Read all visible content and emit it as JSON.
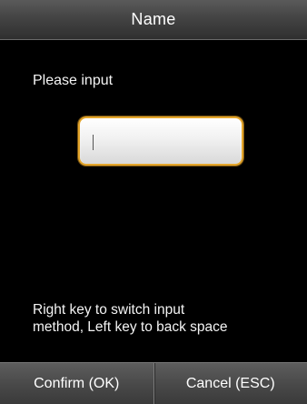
{
  "header": {
    "title": "Name"
  },
  "main": {
    "prompt": "Please input",
    "input": {
      "value": "",
      "caret_visible": true
    },
    "hint_lines": [
      "Right key to switch input",
      "method, Left key to back space"
    ]
  },
  "footer": {
    "confirm_label": "Confirm (OK)",
    "cancel_label": "Cancel (ESC)"
  },
  "colors": {
    "background": "#000000",
    "input_border_accent": "#e3a52b"
  }
}
